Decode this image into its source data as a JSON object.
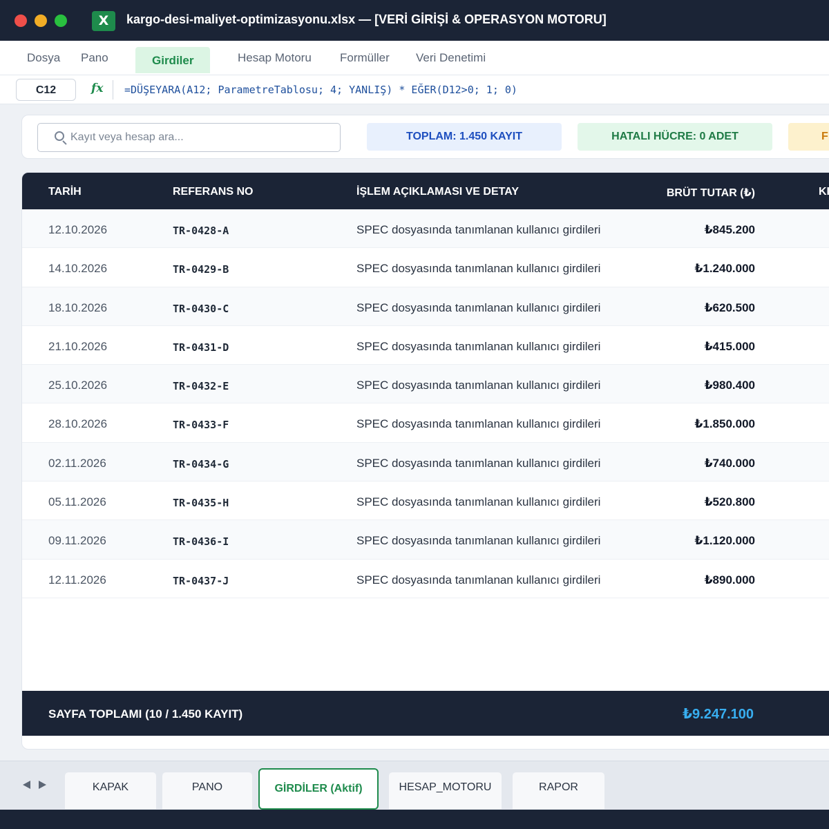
{
  "window": {
    "title": "kargo-desi-maliyet-optimizasyonu.xlsx — [VERİ GİRİŞİ & OPERASYON MOTORU]",
    "app_icon_letter": "X"
  },
  "menu": [
    "Dosya",
    "Pano",
    "Girdiler",
    "Hesap Motoru",
    "Formüller",
    "Veri Denetimi"
  ],
  "formula_bar": {
    "cell_ref": "C12",
    "fx_label": "fx",
    "formula": "=DÜŞEYARA(A12; ParametreTablosu; 4; YANLIŞ) * EĞER(D12>0; 1; 0)"
  },
  "search": {
    "placeholder": "Kayıt veya hesap ara..."
  },
  "badges": {
    "total": "TOPLAM: 1.450 KAYIT",
    "errors": "HATALI HÜCRE: 0 ADET",
    "third": "F"
  },
  "table": {
    "columns": [
      "TARİH",
      "REFERANS NO",
      "İŞLEM AÇIKLAMASI VE DETAY",
      "BRÜT TUTAR (₺)",
      "KI"
    ],
    "rows": [
      {
        "date": "12.10.2026",
        "ref": "TR-0428-A",
        "desc": "SPEC dosyasında tanımlanan kullanıcı girdileri",
        "amount": "₺845.200"
      },
      {
        "date": "14.10.2026",
        "ref": "TR-0429-B",
        "desc": "SPEC dosyasında tanımlanan kullanıcı girdileri",
        "amount": "₺1.240.000"
      },
      {
        "date": "18.10.2026",
        "ref": "TR-0430-C",
        "desc": "SPEC dosyasında tanımlanan kullanıcı girdileri",
        "amount": "₺620.500"
      },
      {
        "date": "21.10.2026",
        "ref": "TR-0431-D",
        "desc": "SPEC dosyasında tanımlanan kullanıcı girdileri",
        "amount": "₺415.000"
      },
      {
        "date": "25.10.2026",
        "ref": "TR-0432-E",
        "desc": "SPEC dosyasında tanımlanan kullanıcı girdileri",
        "amount": "₺980.400"
      },
      {
        "date": "28.10.2026",
        "ref": "TR-0433-F",
        "desc": "SPEC dosyasında tanımlanan kullanıcı girdileri",
        "amount": "₺1.850.000"
      },
      {
        "date": "02.11.2026",
        "ref": "TR-0434-G",
        "desc": "SPEC dosyasında tanımlanan kullanıcı girdileri",
        "amount": "₺740.000"
      },
      {
        "date": "05.11.2026",
        "ref": "TR-0435-H",
        "desc": "SPEC dosyasında tanımlanan kullanıcı girdileri",
        "amount": "₺520.800"
      },
      {
        "date": "09.11.2026",
        "ref": "TR-0436-I",
        "desc": "SPEC dosyasında tanımlanan kullanıcı girdileri",
        "amount": "₺1.120.000"
      },
      {
        "date": "12.11.2026",
        "ref": "TR-0437-J",
        "desc": "SPEC dosyasında tanımlanan kullanıcı girdileri",
        "amount": "₺890.000"
      }
    ],
    "footer_label": "SAYFA TOPLAMI (10 / 1.450 KAYIT)",
    "footer_total": "₺9.247.100"
  },
  "sheet_tabs": [
    "KAPAK",
    "PANO",
    "GİRDİLER (Aktif)",
    "HESAP_MOTORU",
    "RAPOR"
  ],
  "colors": {
    "dark": "#1b2436",
    "accent_green": "#1e8b4c",
    "accent_blue": "#1e4fbf",
    "total_highlight": "#38aef0"
  }
}
